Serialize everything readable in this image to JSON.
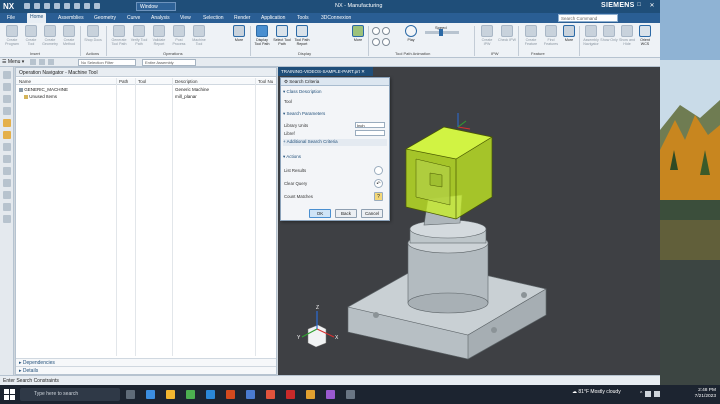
{
  "titlebar": {
    "logo": "NX",
    "window_menu": "Window",
    "app_title": "NX - Manufacturing",
    "brand": "SIEMENS"
  },
  "menubar": {
    "tabs": [
      "File",
      "Home",
      "Assemblies",
      "Geometry",
      "Curve",
      "Analysis",
      "View",
      "Selection",
      "Render",
      "Application",
      "Tools",
      "3DConnexion"
    ],
    "active_tab": "Home",
    "command_search_placeholder": "Search Command"
  },
  "ribbon": {
    "buttons": [
      {
        "label": "Create Program",
        "enabled": false
      },
      {
        "label": "Create Tool",
        "enabled": false
      },
      {
        "label": "Create Geometry",
        "enabled": false
      },
      {
        "label": "Create Method",
        "enabled": false
      },
      {
        "label": "Shop Docs",
        "enabled": false
      },
      {
        "label": "Generate Tool Path",
        "enabled": false
      },
      {
        "label": "Verify Tool Path",
        "enabled": false
      },
      {
        "label": "Validate Report",
        "enabled": false
      },
      {
        "label": "Post Process",
        "enabled": false
      },
      {
        "label": "Machine Tool",
        "enabled": false
      },
      {
        "label": "More",
        "enabled": true
      },
      {
        "label": "Display Tool Path",
        "enabled": true
      },
      {
        "label": "Select Tool Path",
        "enabled": true
      },
      {
        "label": "Tool Path Report",
        "enabled": true
      },
      {
        "label": "More",
        "enabled": true
      },
      {
        "label": "Play",
        "enabled": true
      },
      {
        "label": "Speed",
        "enabled": true
      },
      {
        "label": "Create IPW",
        "enabled": false
      },
      {
        "label": "Check IPW",
        "enabled": false
      },
      {
        "label": "Create Feature",
        "enabled": false
      },
      {
        "label": "Find Features",
        "enabled": false
      },
      {
        "label": "More",
        "enabled": true
      },
      {
        "label": "Assembly Navigator",
        "enabled": false
      },
      {
        "label": "Show Only",
        "enabled": false
      },
      {
        "label": "Show and Hide",
        "enabled": false
      },
      {
        "label": "Orient WCS",
        "enabled": true
      }
    ],
    "groups": [
      "Insert",
      "Actions",
      "Operations",
      "Display",
      "Tool Path Animation",
      "IPW",
      "Feature"
    ]
  },
  "toolbar2": {
    "menu_label": "Menu",
    "filter_label": "No Selection Filter",
    "assembly_label": "Entire Assembly"
  },
  "navigator": {
    "title": "Operation Navigator - Machine Tool",
    "columns": [
      "Name",
      "Path",
      "Tool",
      "Description",
      "Tool Nu"
    ],
    "rows": [
      {
        "name": "GENERIC_MACHINE",
        "description": "Generic Machine"
      },
      {
        "name": "Unused Items",
        "description": "mill_planar"
      }
    ],
    "bottom_panels": [
      "Dependencies",
      "Details"
    ]
  },
  "viewport": {
    "file_tab": "TRAINING-VIDEOS-SAMPLE-PART.prt",
    "axis_labels": [
      "X",
      "Y",
      "Z"
    ]
  },
  "dialog": {
    "title": "Search Criteria",
    "sections": [
      "Class Description",
      "Search Parameters",
      "Actions"
    ],
    "class_description_value": "Tool",
    "library_units_label": "Library Units",
    "library_units_value": "Inch",
    "libref_label": "Libref",
    "libref_value": "",
    "additional_label": "Additional Search Criteria",
    "actions": [
      "List Results",
      "Clear Query",
      "Count Matches"
    ],
    "ok": "OK",
    "back": "Back",
    "cancel": "Cancel"
  },
  "statusbar": {
    "text": "Enter Search Constraints"
  },
  "taskbar": {
    "search_placeholder": "Type here to search",
    "weather_temp": "81°F",
    "weather_text": "Mostly cloudy",
    "time": "2:48 PM",
    "date": "7/21/2023"
  },
  "colors": {
    "titlebar": "#1f4e79",
    "accent_highlight": "#c8f020",
    "viewport_bg": "#3e4044",
    "machine_gray": "#bcc4c8"
  }
}
